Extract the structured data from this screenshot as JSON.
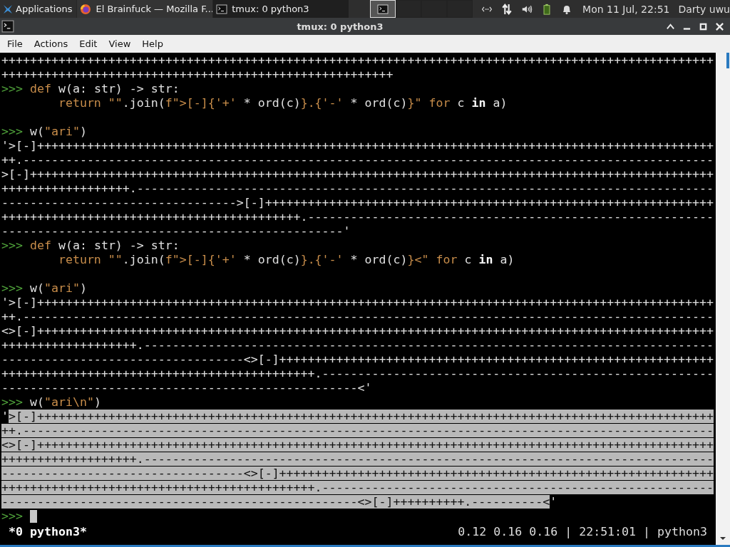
{
  "taskbar": {
    "apps_menu": "Applications",
    "windows": [
      {
        "title": "El Brainfuck — Mozilla F...",
        "kind": "browser",
        "selected": false
      },
      {
        "title": "tmux: 0 python3",
        "kind": "terminal",
        "selected": true
      }
    ],
    "workspaces": [
      {
        "selected": true
      },
      {
        "selected": false
      },
      {
        "selected": false
      },
      {
        "selected": false
      }
    ],
    "clock": "Mon 11 Jul, 22:51",
    "user": "Darty uwu"
  },
  "window": {
    "title": "tmux: 0 python3"
  },
  "menu": [
    "File",
    "Actions",
    "Edit",
    "View",
    "Help"
  ],
  "terminal": {
    "lines": [
      {
        "kind": "text",
        "segments": [
          {
            "t": "++++++++++++++++++++++++++++++++++++++++++++++++++++++++++++++++++++++++++++++++++++++++++++++++++++",
            "kind": "plain"
          }
        ]
      },
      {
        "kind": "text",
        "segments": [
          {
            "t": "+++++++++++++++++++++++++++++++++++++++++++++++++++++++",
            "kind": "plain"
          }
        ]
      },
      {
        "kind": "text",
        "segments": [
          {
            "t": ">>> ",
            "kind": "prompt"
          },
          {
            "t": "def",
            "kind": "keyword"
          },
          {
            "t": " w(a: str) -> str:",
            "kind": "plain"
          }
        ]
      },
      {
        "kind": "text",
        "segments": [
          {
            "t": "        return",
            "kind": "keyword"
          },
          {
            "t": " \"\"",
            "kind": "string"
          },
          {
            "t": ".join(",
            "kind": "plain"
          },
          {
            "t": "f\">[-]{'+'",
            "kind": "string"
          },
          {
            "t": " * ord(c)",
            "kind": "plain"
          },
          {
            "t": "}.{'-'",
            "kind": "string"
          },
          {
            "t": " * ord(c)",
            "kind": "plain"
          },
          {
            "t": "}\"",
            "kind": "string"
          },
          {
            "t": " for",
            "kind": "keyword"
          },
          {
            "t": " c ",
            "kind": "plain"
          },
          {
            "t": "in",
            "kind": "bold"
          },
          {
            "t": " a)",
            "kind": "plain"
          }
        ]
      },
      {
        "kind": "blank"
      },
      {
        "kind": "text",
        "segments": [
          {
            "t": ">>> ",
            "kind": "prompt"
          },
          {
            "t": "w(",
            "kind": "plain"
          },
          {
            "t": "\"ari\"",
            "kind": "string"
          },
          {
            "t": ")",
            "kind": "plain"
          }
        ]
      },
      {
        "kind": "text",
        "segments": [
          {
            "t": "'>[-]+++++++++++++++++++++++++++++++++++++++++++++++++++++++++++++++++++++++++++++++++++++++++++++++",
            "kind": "plain"
          }
        ]
      },
      {
        "kind": "text",
        "segments": [
          {
            "t": "++.-------------------------------------------------------------------------------------------------",
            "kind": "plain"
          }
        ]
      },
      {
        "kind": "text",
        "segments": [
          {
            "t": ">[-]++++++++++++++++++++++++++++++++++++++++++++++++++++++++++++++++++++++++++++++++++++++++++++++++",
            "kind": "plain"
          }
        ]
      },
      {
        "kind": "text",
        "segments": [
          {
            "t": "++++++++++++++++++.---------------------------------------------------------------------------------",
            "kind": "plain"
          }
        ]
      },
      {
        "kind": "text",
        "segments": [
          {
            "t": "--------------------------------->[-]+++++++++++++++++++++++++++++++++++++++++++++++++++++++++++++++",
            "kind": "plain"
          }
        ]
      },
      {
        "kind": "text",
        "segments": [
          {
            "t": "++++++++++++++++++++++++++++++++++++++++++.---------------------------------------------------------",
            "kind": "plain"
          }
        ]
      },
      {
        "kind": "text",
        "segments": [
          {
            "t": "------------------------------------------------'",
            "kind": "plain"
          }
        ]
      },
      {
        "kind": "text",
        "segments": [
          {
            "t": ">>> ",
            "kind": "prompt"
          },
          {
            "t": "def",
            "kind": "keyword"
          },
          {
            "t": " w(a: str) -> str:",
            "kind": "plain"
          }
        ]
      },
      {
        "kind": "text",
        "segments": [
          {
            "t": "        return",
            "kind": "keyword"
          },
          {
            "t": " \"\"",
            "kind": "string"
          },
          {
            "t": ".join(",
            "kind": "plain"
          },
          {
            "t": "f\">[-]{'+'",
            "kind": "string"
          },
          {
            "t": " * ord(c)",
            "kind": "plain"
          },
          {
            "t": "}.{'-'",
            "kind": "string"
          },
          {
            "t": " * ord(c)",
            "kind": "plain"
          },
          {
            "t": "}<\"",
            "kind": "string"
          },
          {
            "t": " for",
            "kind": "keyword"
          },
          {
            "t": " c ",
            "kind": "plain"
          },
          {
            "t": "in",
            "kind": "bold"
          },
          {
            "t": " a)",
            "kind": "plain"
          }
        ]
      },
      {
        "kind": "blank"
      },
      {
        "kind": "text",
        "segments": [
          {
            "t": ">>> ",
            "kind": "prompt"
          },
          {
            "t": "w(",
            "kind": "plain"
          },
          {
            "t": "\"ari\"",
            "kind": "string"
          },
          {
            "t": ")",
            "kind": "plain"
          }
        ]
      },
      {
        "kind": "text",
        "segments": [
          {
            "t": "'>[-]+++++++++++++++++++++++++++++++++++++++++++++++++++++++++++++++++++++++++++++++++++++++++++++++",
            "kind": "plain"
          }
        ]
      },
      {
        "kind": "text",
        "segments": [
          {
            "t": "++.-------------------------------------------------------------------------------------------------",
            "kind": "plain"
          }
        ]
      },
      {
        "kind": "text",
        "segments": [
          {
            "t": "<>[-]+++++++++++++++++++++++++++++++++++++++++++++++++++++++++++++++++++++++++++++++++++++++++++++++",
            "kind": "plain"
          }
        ]
      },
      {
        "kind": "text",
        "segments": [
          {
            "t": "+++++++++++++++++++.--------------------------------------------------------------------------------",
            "kind": "plain"
          }
        ]
      },
      {
        "kind": "text",
        "segments": [
          {
            "t": "----------------------------------<>[-]+++++++++++++++++++++++++++++++++++++++++++++++++++++++++++++",
            "kind": "plain"
          }
        ]
      },
      {
        "kind": "text",
        "segments": [
          {
            "t": "++++++++++++++++++++++++++++++++++++++++++++.-------------------------------------------------------",
            "kind": "plain"
          }
        ]
      },
      {
        "kind": "text",
        "segments": [
          {
            "t": "--------------------------------------------------<'",
            "kind": "plain"
          }
        ]
      },
      {
        "kind": "text",
        "segments": [
          {
            "t": ">>> ",
            "kind": "prompt"
          },
          {
            "t": "w(",
            "kind": "plain"
          },
          {
            "t": "\"ari\\n\"",
            "kind": "string"
          },
          {
            "t": ")",
            "kind": "plain"
          }
        ]
      },
      {
        "kind": "text",
        "segments": [
          {
            "t": "'",
            "kind": "mark"
          },
          {
            "t": ">[-]+++++++++++++++++++++++++++++++++++++++++++++++++++++++++++++++++++++++++++++++++++++++++++++++",
            "kind": "selected"
          }
        ]
      },
      {
        "kind": "text",
        "segments": [
          {
            "t": "++.-------------------------------------------------------------------------------------------------",
            "kind": "selected"
          }
        ]
      },
      {
        "kind": "text",
        "segments": [
          {
            "t": "<>[-]+++++++++++++++++++++++++++++++++++++++++++++++++++++++++++++++++++++++++++++++++++++++++++++++",
            "kind": "selected"
          }
        ]
      },
      {
        "kind": "text",
        "segments": [
          {
            "t": "+++++++++++++++++++.--------------------------------------------------------------------------------",
            "kind": "selected"
          }
        ]
      },
      {
        "kind": "text",
        "segments": [
          {
            "t": "----------------------------------<>[-]+++++++++++++++++++++++++++++++++++++++++++++++++++++++++++++",
            "kind": "selected"
          }
        ]
      },
      {
        "kind": "text",
        "segments": [
          {
            "t": "++++++++++++++++++++++++++++++++++++++++++++.-------------------------------------------------------",
            "kind": "selected"
          }
        ]
      },
      {
        "kind": "text",
        "segments": [
          {
            "t": "--------------------------------------------------<>[-]++++++++++.----------<",
            "kind": "selected"
          },
          {
            "t": "'",
            "kind": "plain"
          }
        ]
      },
      {
        "kind": "text",
        "cursor": true,
        "segments": [
          {
            "t": ">>> ",
            "kind": "prompt"
          }
        ]
      }
    ]
  },
  "status_bar": {
    "window": "*0 python3*",
    "info": "0.12 0.16 0.16 | 22:51:01 | python3"
  }
}
